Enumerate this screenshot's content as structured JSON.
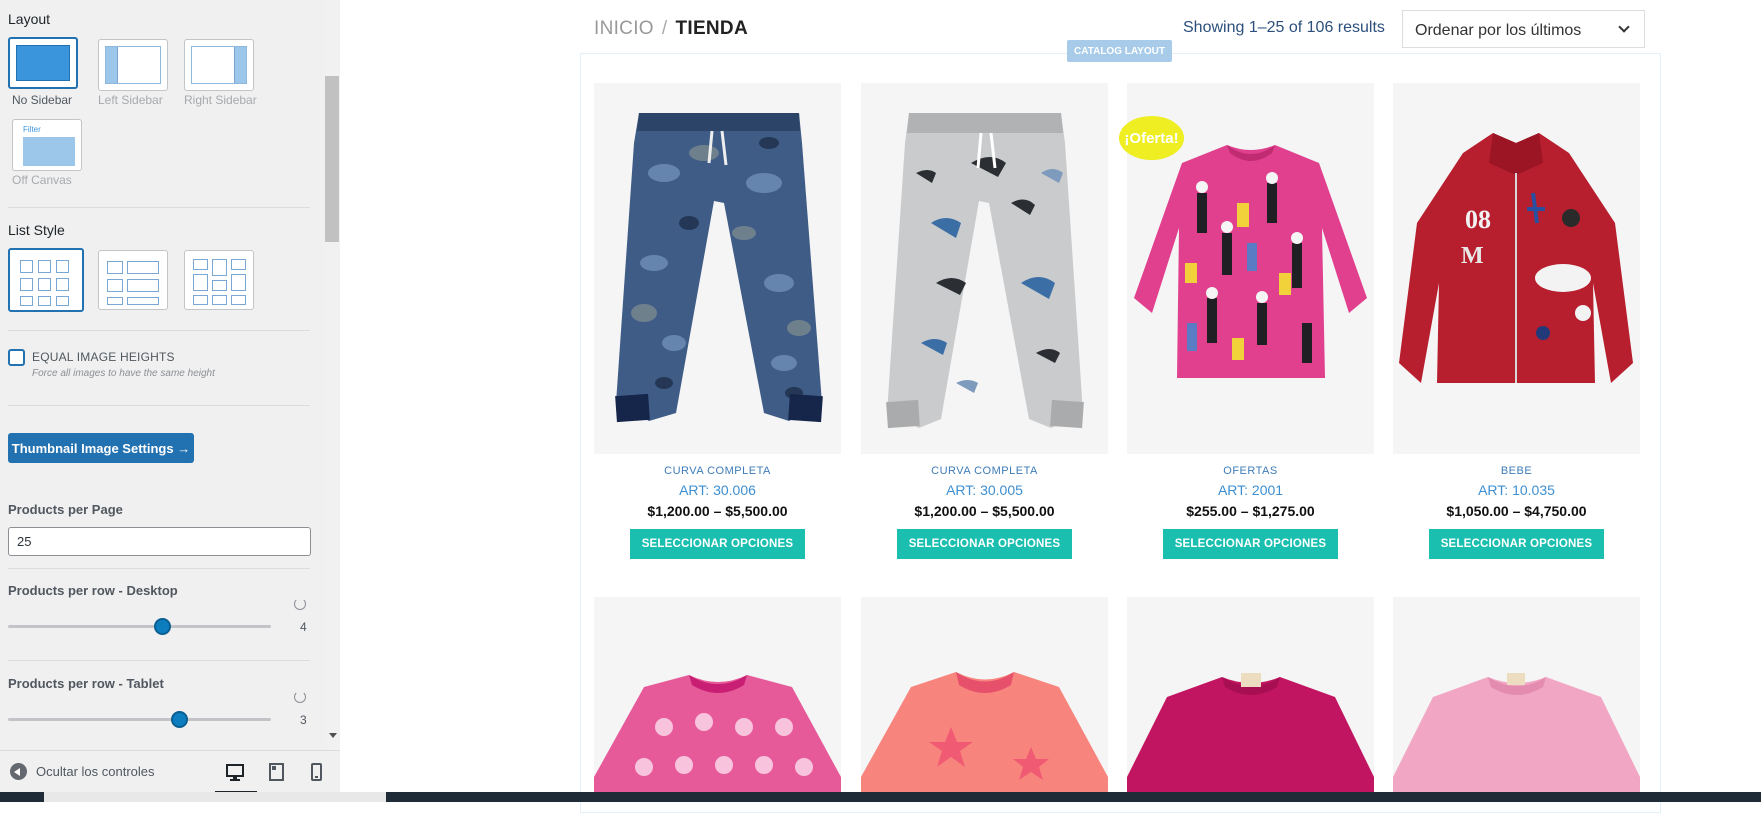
{
  "sidebar": {
    "layout_heading": "Layout",
    "layout_options": [
      {
        "label": "No Sidebar",
        "selected": true
      },
      {
        "label": "Left Sidebar",
        "selected": false
      },
      {
        "label": "Right Sidebar",
        "selected": false
      },
      {
        "label": "Off Canvas",
        "selected": false,
        "tag": "Filter"
      }
    ],
    "list_style_heading": "List Style",
    "equal_heights": {
      "label": "EQUAL IMAGE HEIGHTS",
      "description": "Force all images to have the same height",
      "checked": false
    },
    "thumbnail_button": "Thumbnail Image Settings →",
    "products_per_page": {
      "label": "Products per Page",
      "value": "25"
    },
    "per_row_desktop": {
      "label": "Products per row - Desktop",
      "value": "4"
    },
    "per_row_tablet": {
      "label": "Products per row - Tablet",
      "value": "3"
    },
    "footer": {
      "hide_label": "Ocultar los controles"
    }
  },
  "preview": {
    "breadcrumb": {
      "home": "INICIO",
      "separator": "/",
      "current": "TIENDA"
    },
    "result_count": "Showing 1–25 of 106 results",
    "orderby": "Ordenar por los últimos",
    "catalog_badge": "CATALOG LAYOUT",
    "sale_badge": "¡Oferta!",
    "button_label": "SELECCIONAR OPCIONES",
    "products": [
      {
        "category": "CURVA COMPLETA",
        "title": "ART: 30.006",
        "price": "$1,200.00 – $5,500.00"
      },
      {
        "category": "CURVA COMPLETA",
        "title": "ART: 30.005",
        "price": "$1,200.00 – $5,500.00"
      },
      {
        "category": "OFERTAS",
        "title": "ART: 2001",
        "price": "$255.00 – $1,275.00",
        "on_sale": true
      },
      {
        "category": "BEBE",
        "title": "ART: 10.035",
        "price": "$1,050.00 – $4,750.00"
      }
    ]
  },
  "colors": {
    "accent": "#2271b1",
    "button": "#1abfb0",
    "sale": "#eeee22",
    "link": "#3d8fd1"
  }
}
